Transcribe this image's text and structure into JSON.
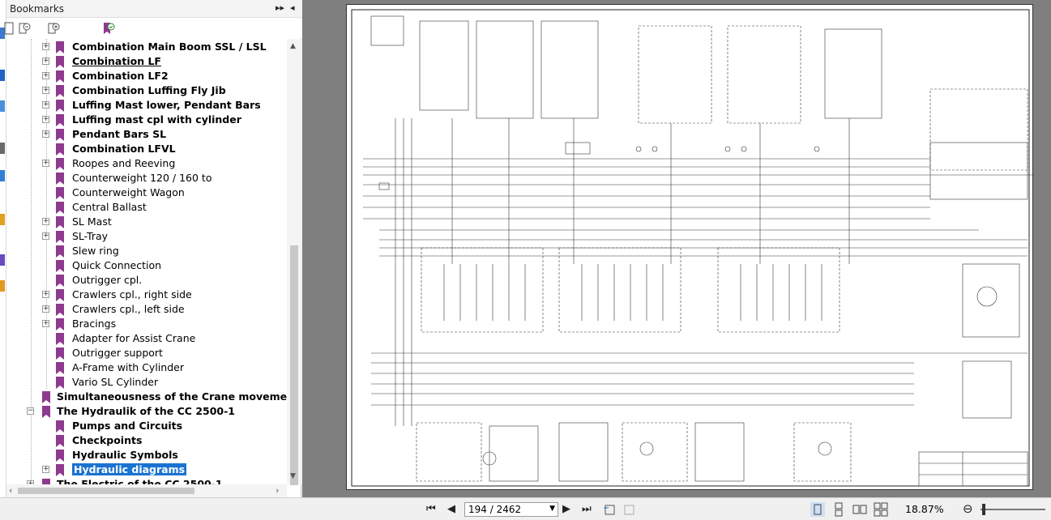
{
  "sidebar": {
    "title": "Bookmarks",
    "items": [
      {
        "label": "Combination Main Boom SSL / LSL",
        "bold": true,
        "expandable": true,
        "level": 2
      },
      {
        "label": "Combination LF",
        "bold": true,
        "underline": true,
        "expandable": true,
        "level": 2
      },
      {
        "label": "Combination LF2",
        "bold": true,
        "expandable": true,
        "level": 2
      },
      {
        "label": "Combination Luffing Fly  Jib",
        "bold": true,
        "expandable": true,
        "level": 2
      },
      {
        "label": "Luffing Mast lower, Pendant Bars",
        "bold": true,
        "expandable": true,
        "level": 2
      },
      {
        "label": "Luffing mast cpl with cylinder",
        "bold": true,
        "expandable": true,
        "level": 2
      },
      {
        "label": "Pendant Bars SL",
        "bold": true,
        "expandable": true,
        "level": 2
      },
      {
        "label": "Combination LFVL",
        "bold": true,
        "expandable": false,
        "level": 2
      },
      {
        "label": "Roopes and Reeving",
        "bold": false,
        "expandable": true,
        "level": 2
      },
      {
        "label": "Counterweight 120 / 160 to",
        "bold": false,
        "expandable": false,
        "level": 2
      },
      {
        "label": "Counterweight Wagon",
        "bold": false,
        "expandable": false,
        "level": 2
      },
      {
        "label": "Central Ballast",
        "bold": false,
        "expandable": false,
        "level": 2
      },
      {
        "label": "SL Mast",
        "bold": false,
        "expandable": true,
        "level": 2
      },
      {
        "label": "SL-Tray",
        "bold": false,
        "expandable": true,
        "level": 2
      },
      {
        "label": "Slew ring",
        "bold": false,
        "expandable": false,
        "level": 2
      },
      {
        "label": "Quick Connection",
        "bold": false,
        "expandable": false,
        "level": 2
      },
      {
        "label": "Outrigger cpl.",
        "bold": false,
        "expandable": false,
        "level": 2
      },
      {
        "label": "Crawlers cpl., right side",
        "bold": false,
        "expandable": true,
        "level": 2
      },
      {
        "label": "Crawlers cpl., left side",
        "bold": false,
        "expandable": true,
        "level": 2
      },
      {
        "label": "Bracings",
        "bold": false,
        "expandable": true,
        "level": 2
      },
      {
        "label": "Adapter for Assist Crane",
        "bold": false,
        "expandable": false,
        "level": 2
      },
      {
        "label": "Outrigger support",
        "bold": false,
        "expandable": false,
        "level": 2
      },
      {
        "label": "A-Frame with Cylinder",
        "bold": false,
        "expandable": false,
        "level": 2
      },
      {
        "label": "Vario SL Cylinder",
        "bold": false,
        "expandable": false,
        "level": 2
      },
      {
        "label": "Simultaneousness of the Crane movement",
        "bold": true,
        "expandable": false,
        "level": 1
      },
      {
        "label": "The Hydraulik of the CC 2500-1",
        "bold": true,
        "expandable": true,
        "expanded": true,
        "level": 1
      },
      {
        "label": "Pumps and Circuits",
        "bold": true,
        "expandable": false,
        "level": 2
      },
      {
        "label": "Checkpoints",
        "bold": true,
        "expandable": false,
        "level": 2
      },
      {
        "label": "Hydraulic Symbols",
        "bold": true,
        "expandable": false,
        "level": 2
      },
      {
        "label": "Hydraulic diagrams",
        "bold": true,
        "expandable": true,
        "level": 2,
        "selected": true
      },
      {
        "label": "The Electric of the CC 2500-1",
        "bold": true,
        "expandable": true,
        "level": 1
      }
    ]
  },
  "status": {
    "page_value": "194 / 2462",
    "zoom": "18.87%"
  },
  "colors": {
    "bookmark": "#8e3a8e",
    "selection": "#1a73d0",
    "viewer_bg": "#7f7f7f"
  }
}
